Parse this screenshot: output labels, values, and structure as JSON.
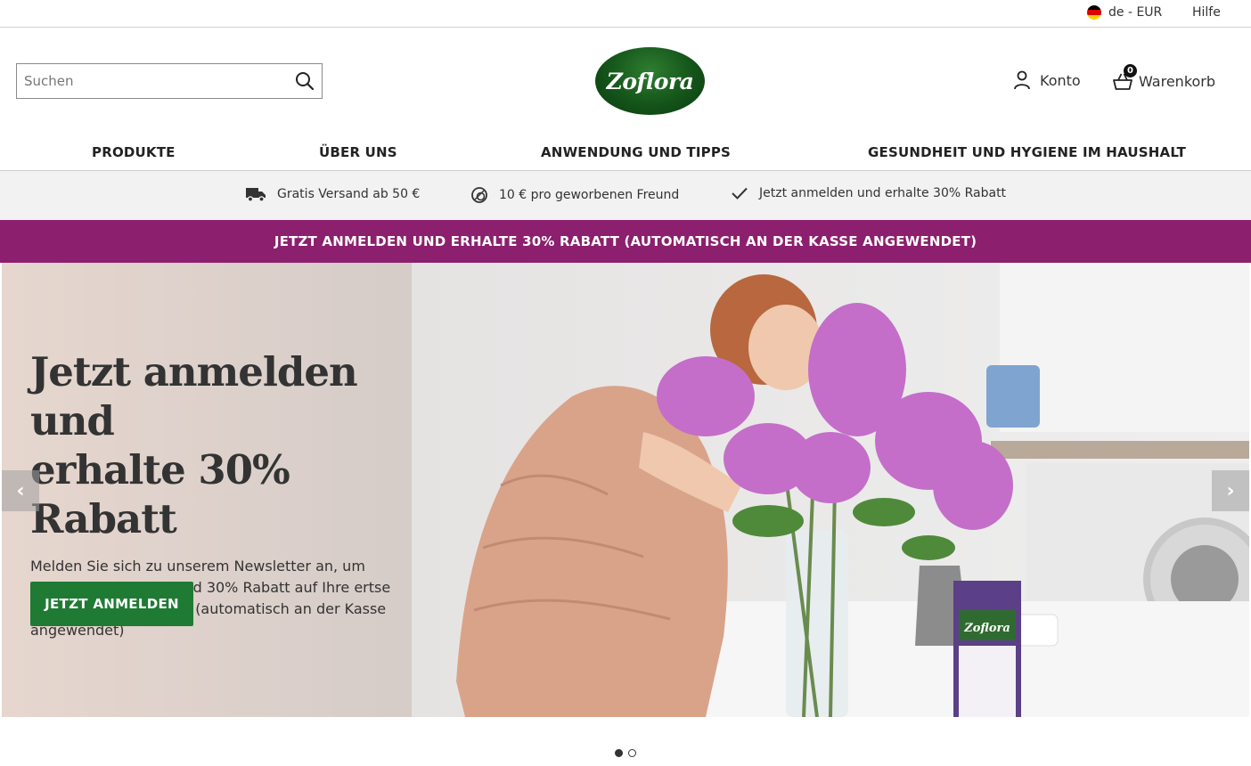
{
  "topbar": {
    "locale_label": "de - EUR",
    "help_label": "Hilfe"
  },
  "header": {
    "search_placeholder": "Suchen",
    "logo_text": "Zoflora",
    "account_label": "Konto",
    "basket_label": "Warenkorb",
    "basket_count": "0"
  },
  "nav": {
    "items": [
      "PRODUKTE",
      "ÜBER UNS",
      "ANWENDUNG UND TIPPS",
      "GESUNDHEIT UND HYGIENE IM HAUSHALT"
    ]
  },
  "usp": {
    "items": [
      {
        "icon": "delivery-truck-icon",
        "text": "Gratis Versand ab 50 €"
      },
      {
        "icon": "coins-icon",
        "text": "10 € pro geworbenen Freund"
      },
      {
        "icon": "checkmark-icon",
        "text": "Jetzt anmelden und erhalte 30% Rabatt"
      }
    ]
  },
  "promo": {
    "text": "JETZT ANMELDEN UND ERHALTE 30% RABATT (AUTOMATISCH AN DER KASSE ANGEWENDET)",
    "color": "#8c1f6e"
  },
  "hero": {
    "title_line1": "Jetzt anmelden und",
    "title_line2": "erhalte 30% Rabatt",
    "subtitle": "Melden Sie sich zu unserem Newsletter an, um exklusive Angebote und 30% Rabatt auf Ihre ertse Betsellung zu erhalten (automatisch an der Kasse angewendet)",
    "cta_label": "JETZT ANMELDEN",
    "cta_color": "#1f7a34",
    "product_logo_text": "Zoflora",
    "prev_label": "‹",
    "next_label": "›"
  },
  "carousel": {
    "slide_count": 2,
    "active_index": 0
  }
}
